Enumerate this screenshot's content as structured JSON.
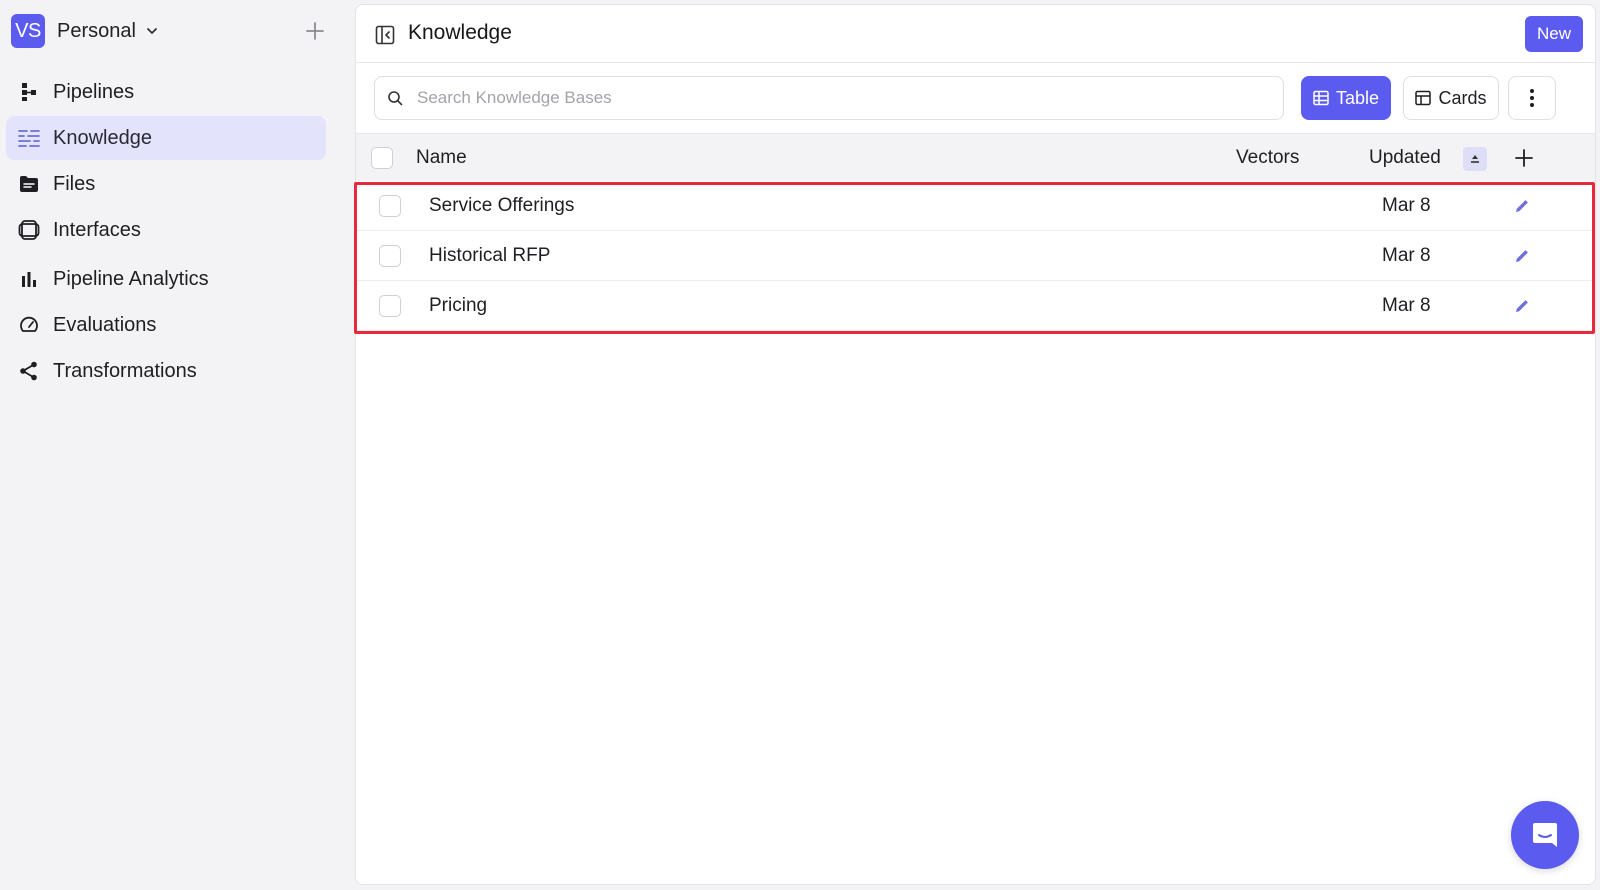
{
  "workspace": {
    "initials": "VS",
    "name": "Personal"
  },
  "sidebar": {
    "items": [
      {
        "label": "Pipelines",
        "icon": "pipelines-icon"
      },
      {
        "label": "Knowledge",
        "icon": "knowledge-icon",
        "active": true
      },
      {
        "label": "Files",
        "icon": "folder-icon"
      },
      {
        "label": "Interfaces",
        "icon": "interfaces-icon"
      },
      {
        "label": "Pipeline Analytics",
        "icon": "bar-chart-icon"
      },
      {
        "label": "Evaluations",
        "icon": "gauge-icon"
      },
      {
        "label": "Transformations",
        "icon": "share-nodes-icon"
      }
    ]
  },
  "header": {
    "title": "Knowledge",
    "new_label": "New"
  },
  "toolbar": {
    "search_placeholder": "Search Knowledge Bases",
    "table_label": "Table",
    "cards_label": "Cards"
  },
  "table": {
    "columns": {
      "name": "Name",
      "vectors": "Vectors",
      "updated": "Updated"
    },
    "rows": [
      {
        "name": "Service Offerings",
        "vectors": "",
        "updated": "Mar 8"
      },
      {
        "name": "Historical RFP",
        "vectors": "",
        "updated": "Mar 8"
      },
      {
        "name": "Pricing",
        "vectors": "",
        "updated": "Mar 8"
      }
    ]
  },
  "colors": {
    "accent": "#5b5bf0",
    "active_nav_bg": "#e3e3fb",
    "highlight": "#e8283d"
  }
}
